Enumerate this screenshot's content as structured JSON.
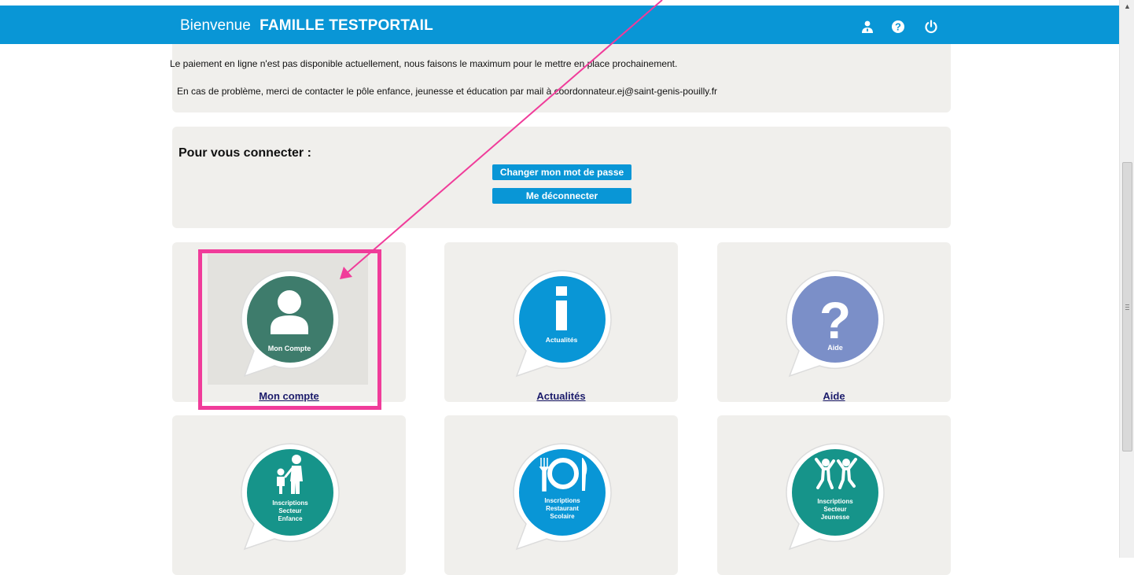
{
  "header": {
    "welcome": "Bienvenue",
    "family_name": "FAMILLE TESTPORTAIL",
    "icons": [
      "user-icon",
      "help-icon",
      "power-icon"
    ]
  },
  "info": {
    "line1": "Le paiement en ligne n'est pas disponible actuellement, nous faisons le maximum pour le mettre en place prochainement.",
    "line2": "En cas de problème, merci de contacter le pôle enfance, jeunesse et éducation par mail à coordonnateur.ej@saint-genis-pouilly.fr"
  },
  "connect": {
    "title": "Pour vous connecter :",
    "change_password": "Changer mon mot de passe",
    "logout": "Me déconnecter"
  },
  "tiles": [
    {
      "id": "mon-compte",
      "label": "Mon compte",
      "bubble": [
        "Mon Compte"
      ],
      "icon": "person-icon",
      "color": "#3e7c6c"
    },
    {
      "id": "actualites",
      "label": "Actualités",
      "bubble": [
        "Actualités"
      ],
      "icon": "info-icon",
      "color": "#0996d6"
    },
    {
      "id": "aide",
      "label": "Aide",
      "bubble": [
        "Aide"
      ],
      "icon": "question-icon",
      "color": "#7b8fc8"
    },
    {
      "id": "inscriptions-enfance",
      "label": "",
      "bubble": [
        "Inscriptions",
        "Secteur",
        "Enfance"
      ],
      "icon": "adult-child-icon",
      "color": "#16948a"
    },
    {
      "id": "inscriptions-restaurant",
      "label": "",
      "bubble": [
        "Inscriptions",
        "Restaurant",
        "Scolaire"
      ],
      "icon": "plate-cutlery-icon",
      "color": "#0996d6"
    },
    {
      "id": "inscriptions-jeunesse",
      "label": "",
      "bubble": [
        "Inscriptions",
        "Secteur",
        "Jeunesse"
      ],
      "icon": "jumping-kids-icon",
      "color": "#16948a"
    }
  ],
  "colors": {
    "header": "#0996d6",
    "panel": "#f0efec",
    "highlight": "#f03c9a",
    "link": "#1b1b6b"
  }
}
